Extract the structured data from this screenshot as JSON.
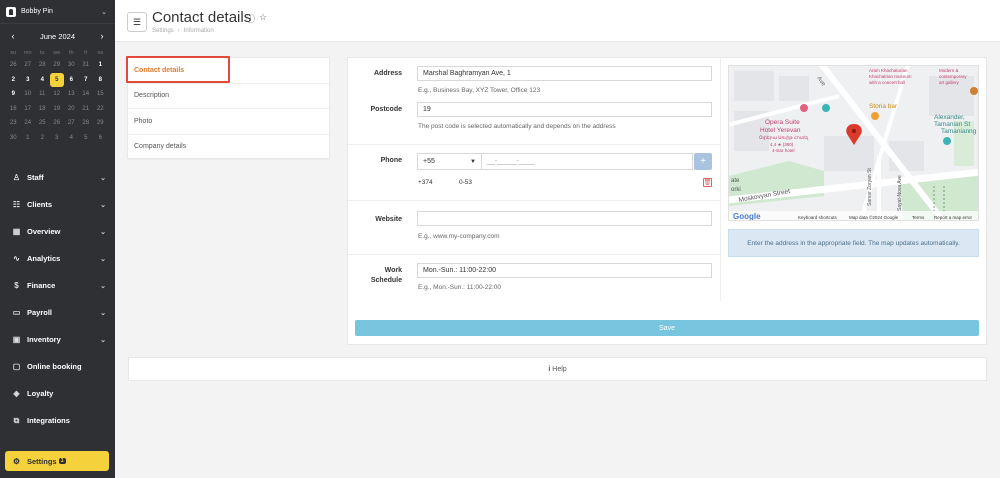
{
  "user": {
    "name": "Bobby Pin"
  },
  "calendar": {
    "month": "June 2024",
    "prev": "‹",
    "next": "›",
    "weekdays": [
      "su",
      "mo",
      "tu",
      "we",
      "th",
      "fr",
      "sa"
    ],
    "weeks": [
      [
        {
          "d": "26",
          "cur": false
        },
        {
          "d": "27",
          "cur": false
        },
        {
          "d": "28",
          "cur": false
        },
        {
          "d": "29",
          "cur": false
        },
        {
          "d": "30",
          "cur": false
        },
        {
          "d": "31",
          "cur": false
        },
        {
          "d": "1",
          "cur": true
        }
      ],
      [
        {
          "d": "2",
          "cur": true
        },
        {
          "d": "3",
          "cur": true
        },
        {
          "d": "4",
          "cur": true
        },
        {
          "d": "5",
          "cur": true,
          "today": true
        },
        {
          "d": "6",
          "cur": true
        },
        {
          "d": "7",
          "cur": true
        },
        {
          "d": "8",
          "cur": true
        }
      ],
      [
        {
          "d": "9",
          "cur": true
        },
        {
          "d": "10",
          "cur": false
        },
        {
          "d": "11",
          "cur": false
        },
        {
          "d": "12",
          "cur": false
        },
        {
          "d": "13",
          "cur": false
        },
        {
          "d": "14",
          "cur": false
        },
        {
          "d": "15",
          "cur": false
        }
      ],
      [
        {
          "d": "16",
          "cur": false
        },
        {
          "d": "17",
          "cur": false
        },
        {
          "d": "18",
          "cur": false
        },
        {
          "d": "19",
          "cur": false
        },
        {
          "d": "20",
          "cur": false
        },
        {
          "d": "21",
          "cur": false
        },
        {
          "d": "22",
          "cur": false
        }
      ],
      [
        {
          "d": "23",
          "cur": false
        },
        {
          "d": "24",
          "cur": false
        },
        {
          "d": "25",
          "cur": false
        },
        {
          "d": "26",
          "cur": false
        },
        {
          "d": "27",
          "cur": false
        },
        {
          "d": "28",
          "cur": false
        },
        {
          "d": "29",
          "cur": false
        }
      ],
      [
        {
          "d": "30",
          "cur": false
        },
        {
          "d": "1",
          "cur": false
        },
        {
          "d": "2",
          "cur": false
        },
        {
          "d": "3",
          "cur": false
        },
        {
          "d": "4",
          "cur": false
        },
        {
          "d": "5",
          "cur": false
        },
        {
          "d": "6",
          "cur": false
        }
      ]
    ]
  },
  "nav": [
    {
      "label": "Staff",
      "icon": "staff-icon",
      "glyph": "♙",
      "chevron": true
    },
    {
      "label": "Clients",
      "icon": "clients-icon",
      "glyph": "☷",
      "chevron": true
    },
    {
      "label": "Overview",
      "icon": "overview-icon",
      "glyph": "▦",
      "chevron": true
    },
    {
      "label": "Analytics",
      "icon": "analytics-icon",
      "glyph": "∿",
      "chevron": true
    },
    {
      "label": "Finance",
      "icon": "finance-icon",
      "glyph": "$",
      "chevron": true
    },
    {
      "label": "Payroll",
      "icon": "payroll-icon",
      "glyph": "▭",
      "chevron": true
    },
    {
      "label": "Inventory",
      "icon": "inventory-icon",
      "glyph": "▣",
      "chevron": true
    },
    {
      "label": "Online booking",
      "icon": "online-booking-icon",
      "glyph": "▢",
      "chevron": false
    },
    {
      "label": "Loyalty",
      "icon": "loyalty-icon",
      "glyph": "◈",
      "chevron": false
    },
    {
      "label": "Integrations",
      "icon": "integrations-icon",
      "glyph": "⧉",
      "chevron": false
    }
  ],
  "settings": {
    "label": "Settings",
    "badge": "1"
  },
  "header": {
    "title": "Contact details",
    "breadcrumb": [
      "Settings",
      "›",
      "Information"
    ]
  },
  "tabs": [
    {
      "label": "Contact details",
      "active": true
    },
    {
      "label": "Description",
      "active": false
    },
    {
      "label": "Photo",
      "active": false
    },
    {
      "label": "Company details",
      "active": false
    }
  ],
  "form": {
    "address": {
      "label": "Address",
      "value": "Marshal Baghramyan Ave, 1",
      "hint": "E.g., Business Bay, XYZ Tower, Office 123"
    },
    "postcode": {
      "label": "Postcode",
      "value": "19",
      "hint": "The post code is selected automatically and depends on the address"
    },
    "phone": {
      "label": "Phone",
      "code": "+55",
      "placeholder": "__-_____-____",
      "saved_code": "+374",
      "saved_number": "0-53",
      "plus": "+",
      "trash": "🗑"
    },
    "website": {
      "label": "Website",
      "value": "",
      "hint": "E.g., www.my-company.com"
    },
    "schedule": {
      "label1": "Work",
      "label2": "Schedule",
      "value": "Mon.-Sun.: 11:00-22:00",
      "hint": "E.g., Mon.-Sun.: 11:00-22:00"
    }
  },
  "map": {
    "labels": {
      "ave": "Ave",
      "opera1": "Opera Suite",
      "opera2": "Hotel Yerevan",
      "opera3": "Օփերա Սուիթ Հոտել",
      "opera4": "4.4 ★ (380)",
      "opera5": "4-star hotel",
      "storia": "Storia bar",
      "alexander1": "Alexander,",
      "alexander2": "Tamanian St",
      "alexander3": "Tamanian",
      "alexander4": "ng",
      "museum1": "Modern &",
      "museum2": "contemporary",
      "museum3": "art gallery",
      "khach1": "Aram Khachaturian",
      "khach2": "Khachatrian museum",
      "khach3": "with a concert hall",
      "moskovyan": "Moskovyan Street",
      "zoryan": "Sarvar Zoryan St",
      "sayat": "Sayat-Nova Ave",
      "ate": "ate",
      "orki": "orki",
      "google": "Google",
      "shortcuts": "Keyboard shortcuts",
      "mapdata": "Map data ©2024 Google",
      "terms": "Terms",
      "report": "Report a map error"
    },
    "info": "Enter the address in the appropriate field. The map updates automatically."
  },
  "save_label": "Save",
  "help_label": "Help",
  "colors": {
    "accent": "#f5d23c",
    "sidebar": "#2f3033",
    "active_tab": "#e57b2a",
    "highlight": "#e2493b",
    "save": "#77c5df"
  }
}
